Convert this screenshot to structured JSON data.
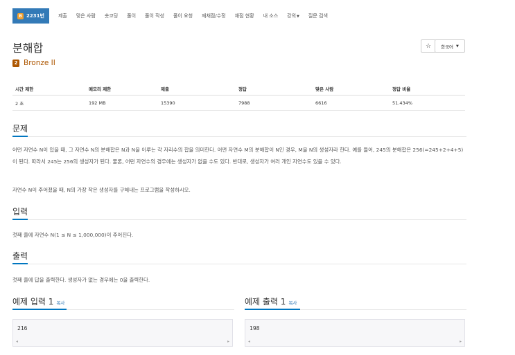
{
  "nav": {
    "active": {
      "tier_label": "B",
      "label": "2231번"
    },
    "items": [
      "제출",
      "맞은 사람",
      "숏코딩",
      "풀이",
      "풀이 작성",
      "풀이 요청",
      "재채점/수정",
      "채점 현황",
      "내 소스",
      "강의",
      "질문 검색"
    ]
  },
  "problem": {
    "title": "분해합",
    "tier_icon": "2",
    "tier": "Bronze II",
    "star": "☆",
    "lang": "한국어"
  },
  "info": {
    "headers": [
      "시간 제한",
      "메모리 제한",
      "제출",
      "정답",
      "맞은 사람",
      "정답 비율"
    ],
    "values": [
      "2 초",
      "192 MB",
      "15390",
      "7988",
      "6616",
      "51.434%"
    ]
  },
  "sections": {
    "desc_title": "문제",
    "desc_p1": "어떤 자연수 N이 있을 때, 그 자연수 N의 분해합은 N과 N을 이루는 각 자리수의 합을 의미한다. 어떤 자연수 M의 분해합이 N인 경우, M을 N의 생성자라 한다. 예를 들어, 245의 분해합은 256(=245+2+4+5)이 된다. 따라서 245는 256의 생성자가 된다. 물론, 어떤 자연수의 경우에는 생성자가 없을 수도 있다. 반대로, 생성자가 여러 개인 자연수도 있을 수 있다.",
    "desc_p2": "자연수 N이 주어졌을 때, N의 가장 작은 생성자를 구해내는 프로그램을 작성하시오.",
    "input_title": "입력",
    "input_text": "첫째 줄에 자연수 N(1 ≤ N ≤ 1,000,000)이 주어진다.",
    "output_title": "출력",
    "output_text": "첫째 줄에 답을 출력한다. 생성자가 없는 경우에는 0을 출력한다."
  },
  "samples": {
    "input_title": "예제 입력 1",
    "output_title": "예제 출력 1",
    "copy": "복사",
    "input_value": "216",
    "output_value": "198",
    "scroll_left": "◂",
    "scroll_right": "▸"
  }
}
